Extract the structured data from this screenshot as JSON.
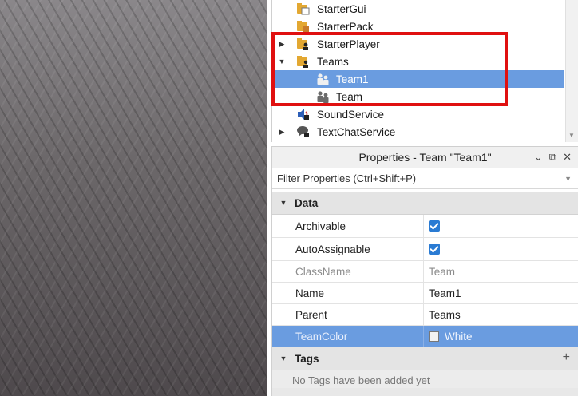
{
  "explorer": {
    "items": [
      {
        "label": "StarterGui",
        "icon": "starter-gui-icon",
        "arrow": ""
      },
      {
        "label": "StarterPack",
        "icon": "starter-pack-icon",
        "arrow": ""
      },
      {
        "label": "StarterPlayer",
        "icon": "starter-player-icon",
        "arrow": "▶"
      },
      {
        "label": "Teams",
        "icon": "teams-icon",
        "arrow": "▼"
      },
      {
        "label": "Team1",
        "icon": "team-icon",
        "arrow": ""
      },
      {
        "label": "Team",
        "icon": "team-icon",
        "arrow": ""
      },
      {
        "label": "SoundService",
        "icon": "sound-service-icon",
        "arrow": ""
      },
      {
        "label": "TextChatService",
        "icon": "text-chat-service-icon",
        "arrow": "▶"
      }
    ]
  },
  "properties": {
    "title": "Properties - Team \"Team1\"",
    "filter_placeholder": "Filter Properties (Ctrl+Shift+P)",
    "sections": {
      "data": {
        "label": "Data",
        "rows": [
          {
            "name": "Archivable",
            "value": "",
            "checked": true
          },
          {
            "name": "AutoAssignable",
            "value": "",
            "checked": true
          },
          {
            "name": "ClassName",
            "value": "Team"
          },
          {
            "name": "Name",
            "value": "Team1"
          },
          {
            "name": "Parent",
            "value": "Teams"
          },
          {
            "name": "TeamColor",
            "value": "White"
          }
        ]
      },
      "tags": {
        "label": "Tags",
        "empty_text": "No Tags have been added yet"
      }
    }
  },
  "colors": {
    "selection": "#6a9ce0",
    "highlight_border": "#e01010",
    "checkbox": "#2a7bd3"
  }
}
